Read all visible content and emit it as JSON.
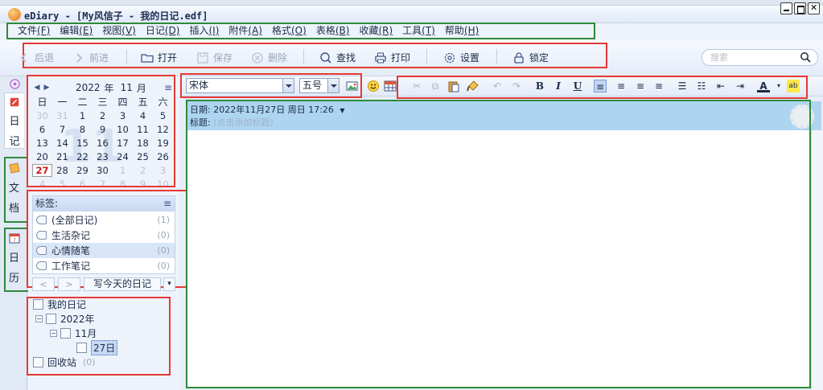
{
  "window": {
    "title": "eDiary - [My风信子 - 我的日记.edf]"
  },
  "menu": [
    {
      "label": "文件",
      "key": "(F)"
    },
    {
      "label": "编辑",
      "key": "(E)"
    },
    {
      "label": "视图",
      "key": "(V)"
    },
    {
      "label": "日记",
      "key": "(D)"
    },
    {
      "label": "插入",
      "key": "(I)"
    },
    {
      "label": "附件",
      "key": "(A)"
    },
    {
      "label": "格式",
      "key": "(O)"
    },
    {
      "label": "表格",
      "key": "(B)"
    },
    {
      "label": "收藏",
      "key": "(R)"
    },
    {
      "label": "工具",
      "key": "(T)"
    },
    {
      "label": "帮助",
      "key": "(H)"
    }
  ],
  "toolbar": {
    "back": "后退",
    "forward": "前进",
    "open": "打开",
    "save": "保存",
    "delete": "删除",
    "find": "查找",
    "print": "打印",
    "settings": "设置",
    "lock": "锁定",
    "search_placeholder": "搜索"
  },
  "vtabs": {
    "diary": [
      "日",
      "记"
    ],
    "doc": [
      "文",
      "档"
    ],
    "calendar": [
      "日",
      "历"
    ]
  },
  "calendar": {
    "year": "2022",
    "year_unit": "年",
    "month": "11",
    "month_unit": "月",
    "weekdays": [
      "日",
      "一",
      "二",
      "三",
      "四",
      "五",
      "六"
    ],
    "weeks": [
      [
        {
          "d": "30",
          "o": true
        },
        {
          "d": "31",
          "o": true
        },
        {
          "d": "1"
        },
        {
          "d": "2"
        },
        {
          "d": "3"
        },
        {
          "d": "4"
        },
        {
          "d": "5"
        }
      ],
      [
        {
          "d": "6"
        },
        {
          "d": "7"
        },
        {
          "d": "8"
        },
        {
          "d": "9"
        },
        {
          "d": "10"
        },
        {
          "d": "11"
        },
        {
          "d": "12"
        }
      ],
      [
        {
          "d": "13"
        },
        {
          "d": "14"
        },
        {
          "d": "15"
        },
        {
          "d": "16"
        },
        {
          "d": "17"
        },
        {
          "d": "18"
        },
        {
          "d": "19"
        }
      ],
      [
        {
          "d": "20"
        },
        {
          "d": "21"
        },
        {
          "d": "22"
        },
        {
          "d": "23"
        },
        {
          "d": "24"
        },
        {
          "d": "25"
        },
        {
          "d": "26"
        }
      ],
      [
        {
          "d": "27",
          "t": true
        },
        {
          "d": "28"
        },
        {
          "d": "29"
        },
        {
          "d": "30"
        },
        {
          "d": "1",
          "o": true
        },
        {
          "d": "2",
          "o": true
        },
        {
          "d": "3",
          "o": true
        }
      ],
      [
        {
          "d": "4",
          "o": true
        },
        {
          "d": "5",
          "o": true
        },
        {
          "d": "6",
          "o": true
        },
        {
          "d": "7",
          "o": true
        },
        {
          "d": "8",
          "o": true
        },
        {
          "d": "9",
          "o": true
        },
        {
          "d": "10",
          "o": true
        }
      ]
    ],
    "watermark": "11"
  },
  "tags": {
    "header": "标签:",
    "items": [
      {
        "label": "(全部日记)",
        "count": "(1)"
      },
      {
        "label": "生活杂记",
        "count": "(0)"
      },
      {
        "label": "心情随笔",
        "count": "(0)"
      },
      {
        "label": "工作笔记",
        "count": "(0)"
      }
    ]
  },
  "nav": {
    "prev": "<",
    "next": ">",
    "write_today": "写今天的日记",
    "dropdown": "▾"
  },
  "tree": {
    "root": "我的日记",
    "year": "2022年",
    "month": "11月",
    "day": "27日",
    "recycle": "回收站",
    "recycle_count": "(0)"
  },
  "editor_toolbar": {
    "font": "宋体",
    "size": "五号"
  },
  "editor": {
    "date_label": "日期:",
    "date_value": "2022年11月27日 周日 17:26",
    "title_label": "标题:",
    "title_placeholder": "(点击添加标题)"
  },
  "colors": {
    "accent_red": "#e53935",
    "accent_green": "#2e8a3a",
    "header_blue": "#aed5f0",
    "today_red": "#d01818"
  }
}
